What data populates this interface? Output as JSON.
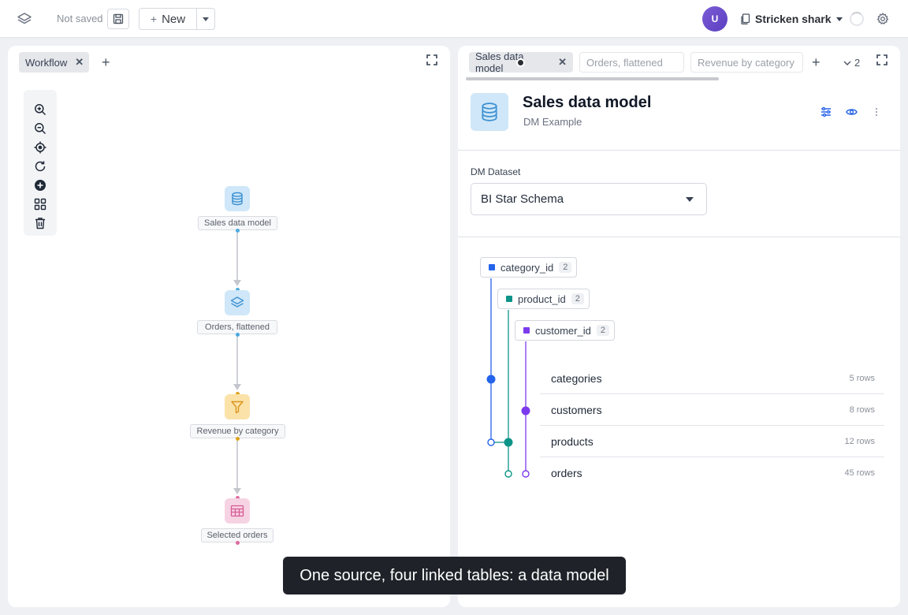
{
  "topbar": {
    "status": "Not saved",
    "new_label": "New",
    "avatar_initial": "U",
    "workspace_name": "Stricken shark"
  },
  "left_panel": {
    "tab": "Workflow",
    "nodes": [
      {
        "label": "Sales data model",
        "icon": "database-icon",
        "color": "#cfe7f8"
      },
      {
        "label": "Orders, flattened",
        "icon": "layers-icon",
        "color": "#cfe7f8"
      },
      {
        "label": "Revenue by category",
        "icon": "funnel-icon",
        "color": "#fbe2a9"
      },
      {
        "label": "Selected orders",
        "icon": "table-icon",
        "color": "#f6d3e3"
      }
    ]
  },
  "right_panel": {
    "tabs": [
      "Sales data model",
      "Orders, flattened",
      "Revenue by category"
    ],
    "overflow_count": "2",
    "title": "Sales data model",
    "subtitle": "DM Example",
    "dataset_label": "DM Dataset",
    "dataset_value": "BI Star Schema",
    "keys": [
      {
        "name": "category_id",
        "count": "2",
        "color": "#2563eb"
      },
      {
        "name": "product_id",
        "count": "2",
        "color": "#0d9488"
      },
      {
        "name": "customer_id",
        "count": "2",
        "color": "#7c3aed"
      }
    ],
    "tables": [
      {
        "name": "categories",
        "rows": "5 rows"
      },
      {
        "name": "customers",
        "rows": "8 rows"
      },
      {
        "name": "products",
        "rows": "12 rows"
      },
      {
        "name": "orders",
        "rows": "45 rows"
      }
    ]
  },
  "caption": "One source, four linked tables: a data model"
}
